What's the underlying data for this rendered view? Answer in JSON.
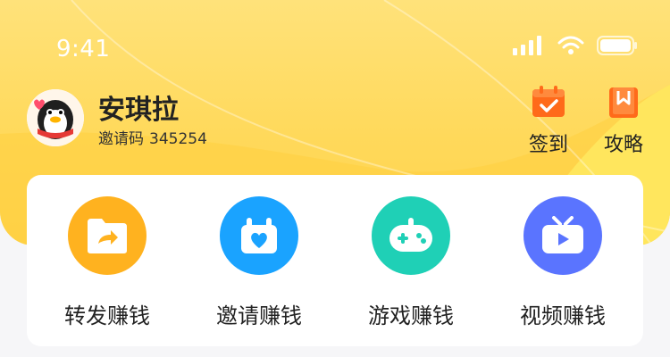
{
  "status_bar": {
    "time": "9:41"
  },
  "profile": {
    "name": "安琪拉",
    "invite_label": "邀请码",
    "invite_code": "345254"
  },
  "top_actions": [
    {
      "label": "签到",
      "icon": "calendar-check-icon",
      "color": "#ff6a1a"
    },
    {
      "label": "攻略",
      "icon": "guide-book-icon",
      "color": "#ff6a1a"
    }
  ],
  "earn_items": [
    {
      "label": "转发赚钱",
      "icon": "share-folder-icon",
      "color": "#ffb21f"
    },
    {
      "label": "邀请赚钱",
      "icon": "invite-heart-icon",
      "color": "#1aa3ff"
    },
    {
      "label": "游戏赚钱",
      "icon": "gamepad-icon",
      "color": "#1fd0b6"
    },
    {
      "label": "视频赚钱",
      "icon": "tv-play-icon",
      "color": "#5a74ff"
    }
  ]
}
